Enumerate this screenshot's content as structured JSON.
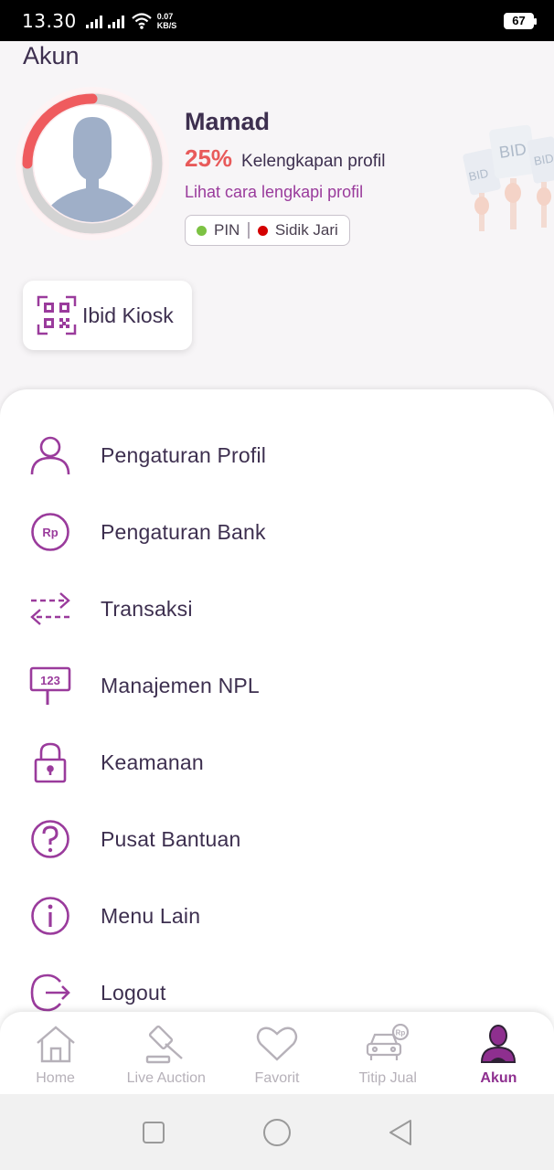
{
  "status_bar": {
    "time": "13.30",
    "network_speed_value": "0.07",
    "network_speed_unit": "KB/S",
    "battery": "67"
  },
  "page": {
    "title": "Akun"
  },
  "profile": {
    "name": "Mamad",
    "completion_percent": "25%",
    "completion_fraction": 0.25,
    "completion_label": "Kelengkapan profil",
    "howto_link": "Lihat cara lengkapi profil",
    "security": [
      {
        "label": "PIN",
        "status_color": "#7cc243"
      },
      {
        "label": "Sidik Jari",
        "status_color": "#d40000"
      }
    ]
  },
  "illustration": {
    "sign_text": "BID"
  },
  "kiosk": {
    "label": "Ibid Kiosk"
  },
  "menu": [
    {
      "label": "Pengaturan Profil",
      "icon": "person-icon"
    },
    {
      "label": "Pengaturan Bank",
      "icon": "rupiah-icon",
      "icon_text": "Rp"
    },
    {
      "label": "Transaksi",
      "icon": "transfer-arrows-icon"
    },
    {
      "label": "Manajemen NPL",
      "icon": "npl-sign-icon",
      "icon_text": "123"
    },
    {
      "label": "Keamanan",
      "icon": "padlock-icon"
    },
    {
      "label": "Pusat Bantuan",
      "icon": "question-icon"
    },
    {
      "label": "Menu Lain",
      "icon": "info-icon"
    },
    {
      "label": "Logout",
      "icon": "logout-icon"
    }
  ],
  "bottom_nav": {
    "active": "Akun",
    "items": [
      {
        "label": "Home",
        "icon": "home-icon"
      },
      {
        "label": "Live Auction",
        "icon": "gavel-icon"
      },
      {
        "label": "Favorit",
        "icon": "heart-icon"
      },
      {
        "label": "Titip Jual",
        "icon": "car-rp-icon",
        "icon_text": "Rp"
      },
      {
        "label": "Akun",
        "icon": "account-icon"
      }
    ]
  },
  "colors": {
    "brand_purple": "#8e2f8f",
    "link_purple": "#9a3b9c",
    "accent_red": "#e85a5a",
    "text_dark": "#3d2f4f",
    "inactive_grey": "#b6b1b9"
  }
}
